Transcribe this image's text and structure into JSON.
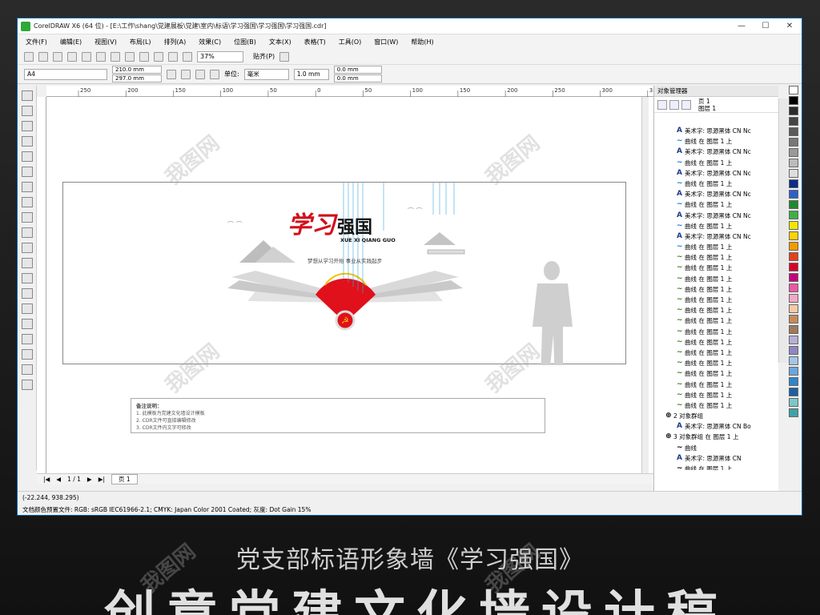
{
  "window": {
    "title": "CorelDRAW X6 (64 位) - [E:\\工作\\shang\\党建展板\\党建\\室内\\标语\\学习强国\\学习强国\\学习强国.cdr]",
    "controls": [
      "—",
      "☐",
      "✕"
    ]
  },
  "menu": [
    "文件(F)",
    "编辑(E)",
    "视图(V)",
    "布局(L)",
    "排列(A)",
    "效果(C)",
    "位图(B)",
    "文本(X)",
    "表格(T)",
    "工具(O)",
    "窗口(W)",
    "帮助(H)"
  ],
  "toolbar": {
    "zoom": "37%",
    "snap": "贴齐(P)"
  },
  "propbar": {
    "paper": "A4",
    "width": "210.0 mm",
    "height": "297.0 mm",
    "unit_label": "单位:",
    "unit": "毫米",
    "nudge": "1.0 mm",
    "dup_x": "0.0 mm",
    "dup_y": "0.0 mm"
  },
  "ruler": {
    "ticks": [
      "250",
      "200",
      "150",
      "100",
      "50",
      "0",
      "50",
      "100",
      "150",
      "200",
      "250",
      "300",
      "350"
    ]
  },
  "design": {
    "title_red": "学习",
    "title_black": "强国",
    "pinyin": "XUE XI QIANG GUO",
    "slogan": "梦想从学习开始  事业从实践起步"
  },
  "notes": {
    "heading": "备注说明：",
    "lines": [
      "1. 此模板为党建文化墙设计模板",
      "2. CDR文件可直接编辑修改",
      "3. CDR文件内文字可修改"
    ]
  },
  "pages": {
    "counter": "1 / 1",
    "tab": "页 1"
  },
  "status": {
    "coords": "(-22.244, 938.295)",
    "profile": "文档颜色预置文件: RGB: sRGB IEC61966-2.1; CMYK: Japan Color 2001 Coated; 灰度: Dot Gain 15%"
  },
  "object_manager": {
    "title": "对象管理器",
    "page": "页 1",
    "layer": "图层 1",
    "items": [
      {
        "icon": "A",
        "type": "text",
        "label": "美术字: 思源黑体 CN Nc"
      },
      {
        "icon": "curve",
        "type": "curve",
        "label": "曲线 在 图层 1 上"
      },
      {
        "icon": "A",
        "type": "text",
        "label": "美术字: 思源黑体 CN Nc"
      },
      {
        "icon": "curve",
        "type": "curve",
        "label": "曲线 在 图层 1 上"
      },
      {
        "icon": "A",
        "type": "text",
        "label": "美术字: 思源黑体 CN Nc"
      },
      {
        "icon": "curve",
        "type": "curve",
        "label": "曲线 在 图层 1 上"
      },
      {
        "icon": "A",
        "type": "text",
        "label": "美术字: 思源黑体 CN Nc"
      },
      {
        "icon": "curve",
        "type": "curve",
        "label": "曲线 在 图层 1 上"
      },
      {
        "icon": "A",
        "type": "text",
        "label": "美术字: 思源黑体 CN Nc"
      },
      {
        "icon": "curve",
        "type": "curve",
        "label": "曲线 在 图层 1 上"
      },
      {
        "icon": "A",
        "type": "text",
        "label": "美术字: 思源黑体 CN Nc"
      },
      {
        "icon": "curve",
        "type": "curve",
        "label": "曲线 在 图层 1 上"
      },
      {
        "icon": "green",
        "type": "curve",
        "label": "曲线 在 图层 1 上"
      },
      {
        "icon": "green",
        "type": "curve",
        "label": "曲线 在 图层 1 上"
      },
      {
        "icon": "green",
        "type": "curve",
        "label": "曲线 在 图层 1 上"
      },
      {
        "icon": "green",
        "type": "curve",
        "label": "曲线 在 图层 1 上"
      },
      {
        "icon": "green",
        "type": "curve",
        "label": "曲线 在 图层 1 上"
      },
      {
        "icon": "green",
        "type": "curve",
        "label": "曲线 在 图层 1 上"
      },
      {
        "icon": "green",
        "type": "curve",
        "label": "曲线 在 图层 1 上"
      },
      {
        "icon": "green",
        "type": "curve",
        "label": "曲线 在 图层 1 上"
      },
      {
        "icon": "green",
        "type": "curve",
        "label": "曲线 在 图层 1 上"
      },
      {
        "icon": "green",
        "type": "curve",
        "label": "曲线 在 图层 1 上"
      },
      {
        "icon": "green",
        "type": "curve",
        "label": "曲线 在 图层 1 上"
      },
      {
        "icon": "green",
        "type": "curve",
        "label": "曲线 在 图层 1 上"
      },
      {
        "icon": "green",
        "type": "curve",
        "label": "曲线 在 图层 1 上"
      },
      {
        "icon": "green",
        "type": "curve",
        "label": "曲线 在 图层 1 上"
      },
      {
        "icon": "green",
        "type": "curve",
        "label": "曲线 在 图层 1 上"
      },
      {
        "icon": "group",
        "type": "group",
        "label": "2 对象群组"
      },
      {
        "icon": "A",
        "type": "text",
        "label": "美术字: 思源黑体 CN Bo"
      },
      {
        "icon": "group",
        "type": "group",
        "label": "3 对象群组 在 图层 1 上"
      },
      {
        "icon": "black",
        "type": "curve",
        "label": "曲线"
      },
      {
        "icon": "A",
        "type": "text",
        "label": "美术字: 思源黑体 CN"
      },
      {
        "icon": "black",
        "type": "curve",
        "label": "曲线 在 图层 1 上"
      },
      {
        "icon": "red",
        "type": "curve",
        "label": "曲线 在 图层 1 上"
      }
    ]
  },
  "palette_colors": [
    "#ffffff",
    "#000000",
    "#2b2b2b",
    "#444",
    "#5a5a5a",
    "#777",
    "#999",
    "#bbb",
    "#ddd",
    "#0c2a8a",
    "#2b62c5",
    "#1e8a2e",
    "#3cb043",
    "#f2e600",
    "#ffd200",
    "#f59a00",
    "#e3411c",
    "#d6002a",
    "#c4007a",
    "#e85aa4",
    "#f3a8c8",
    "#f7c9a8",
    "#c58b5a",
    "#9d7a5c",
    "#b5b0d6",
    "#8f87c4",
    "#a3c5e6",
    "#6aa7dd",
    "#2f86c9",
    "#1f5fa0",
    "#7ec7c8",
    "#3ea2a6"
  ],
  "caption": "党支部标语形象墙《学习强国》",
  "bigtitle": "创意党建文化墙设计稿",
  "watermark": "我图网"
}
